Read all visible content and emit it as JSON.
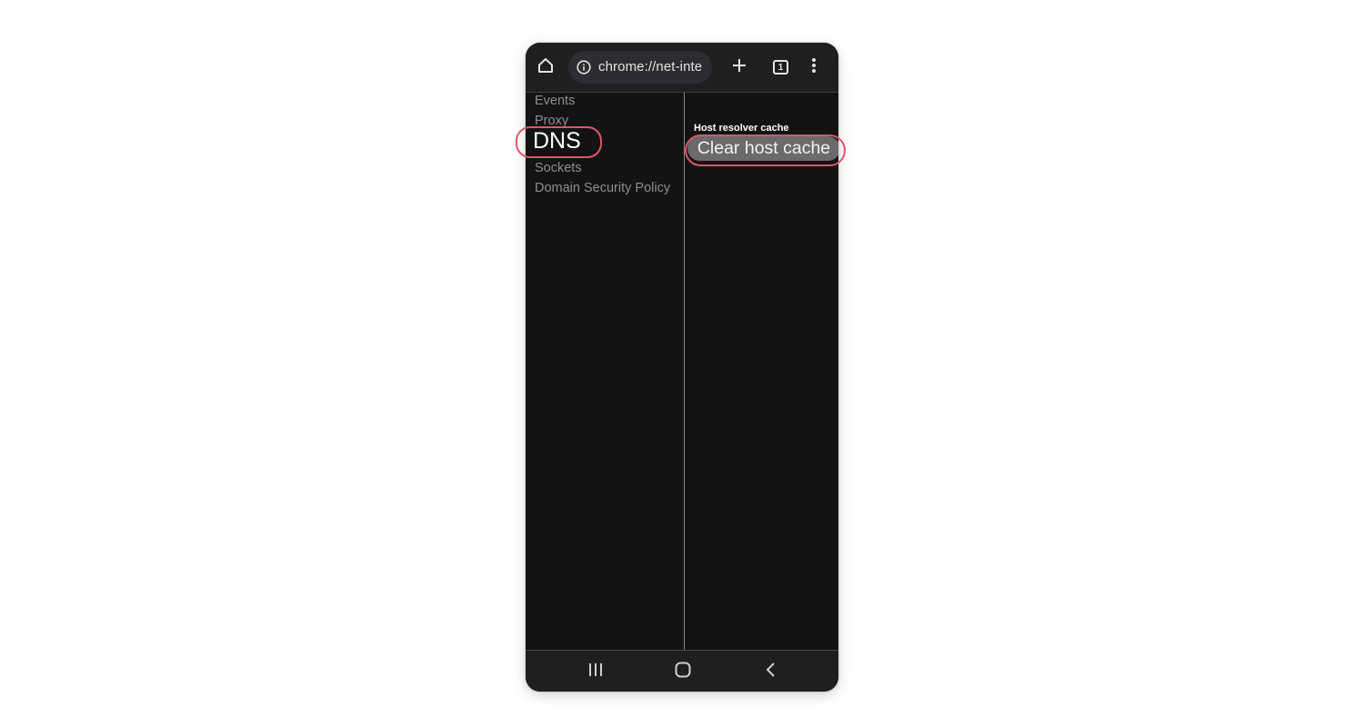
{
  "browser": {
    "url": "chrome://net-internals/#dns",
    "url_display": "chrome://net-inte",
    "tab_count": "1",
    "icons": {
      "home": "home-icon",
      "info": "info-icon",
      "new_tab": "plus-icon",
      "tabs": "tab-switcher-icon",
      "menu": "more-vert-icon"
    }
  },
  "sidebar": {
    "items": [
      {
        "label": "Events",
        "active": false
      },
      {
        "label": "Proxy",
        "active": false
      },
      {
        "label": "DNS",
        "active": true
      },
      {
        "label": "Sockets",
        "active": false
      },
      {
        "label": "Domain Security Policy",
        "active": false
      }
    ]
  },
  "main": {
    "section_title": "Host resolver cache",
    "clear_button": "Clear host cache"
  },
  "android_nav": {
    "icons": [
      "recents-icon",
      "home-icon",
      "back-icon"
    ]
  },
  "colors": {
    "highlight": "#e0566a",
    "background": "#131314",
    "button": "#6b6b6b"
  }
}
